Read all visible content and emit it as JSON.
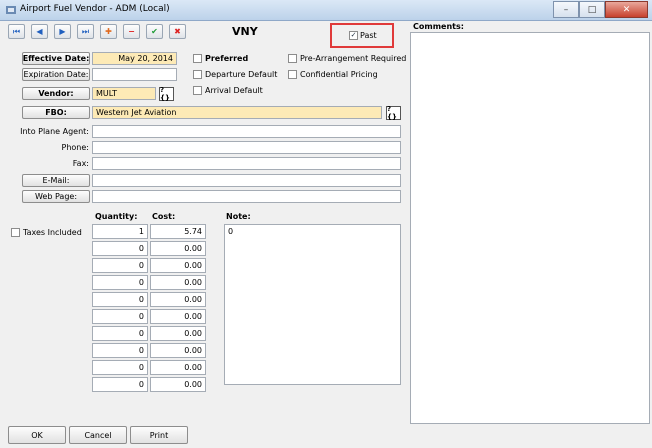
{
  "window": {
    "title": "Airport Fuel Vendor - ADM (Local)"
  },
  "station": "VNY",
  "past_label": "Past",
  "checkboxes": {
    "preferred": "Preferred",
    "departure_default": "Departure Default",
    "arrival_default": "Arrival Default",
    "pre_arrangement_required": "Pre-Arrangement Required",
    "confidential_pricing": "Confidential Pricing",
    "taxes_included": "Taxes Included"
  },
  "buttons": {
    "effective_date": "Effective Date:",
    "expiration_date": "Expiration Date:",
    "vendor": "Vendor:",
    "fbo": "FBO:",
    "email": "E-Mail:",
    "web_page": "Web Page:",
    "lookup": "?{}",
    "ok": "OK",
    "cancel": "Cancel",
    "print": "Print"
  },
  "fields": {
    "effective_date": "May 20, 2014",
    "expiration_date": "",
    "vendor": "MULT",
    "fbo": "Western Jet Aviation",
    "into_plane_agent": "",
    "phone": "",
    "fax": "",
    "email": "",
    "web_page": ""
  },
  "labels": {
    "into_plane_agent": "Into Plane Agent:",
    "phone": "Phone:",
    "fax": "Fax:",
    "quantity": "Quantity:",
    "cost": "Cost:",
    "note": "Note:",
    "comments": "Comments:"
  },
  "rows": [
    {
      "quantity": "1",
      "cost": "5.74"
    },
    {
      "quantity": "0",
      "cost": "0.00"
    },
    {
      "quantity": "0",
      "cost": "0.00"
    },
    {
      "quantity": "0",
      "cost": "0.00"
    },
    {
      "quantity": "0",
      "cost": "0.00"
    },
    {
      "quantity": "0",
      "cost": "0.00"
    },
    {
      "quantity": "0",
      "cost": "0.00"
    },
    {
      "quantity": "0",
      "cost": "0.00"
    },
    {
      "quantity": "0",
      "cost": "0.00"
    },
    {
      "quantity": "0",
      "cost": "0.00"
    }
  ],
  "note_value": "0",
  "comments_value": ""
}
